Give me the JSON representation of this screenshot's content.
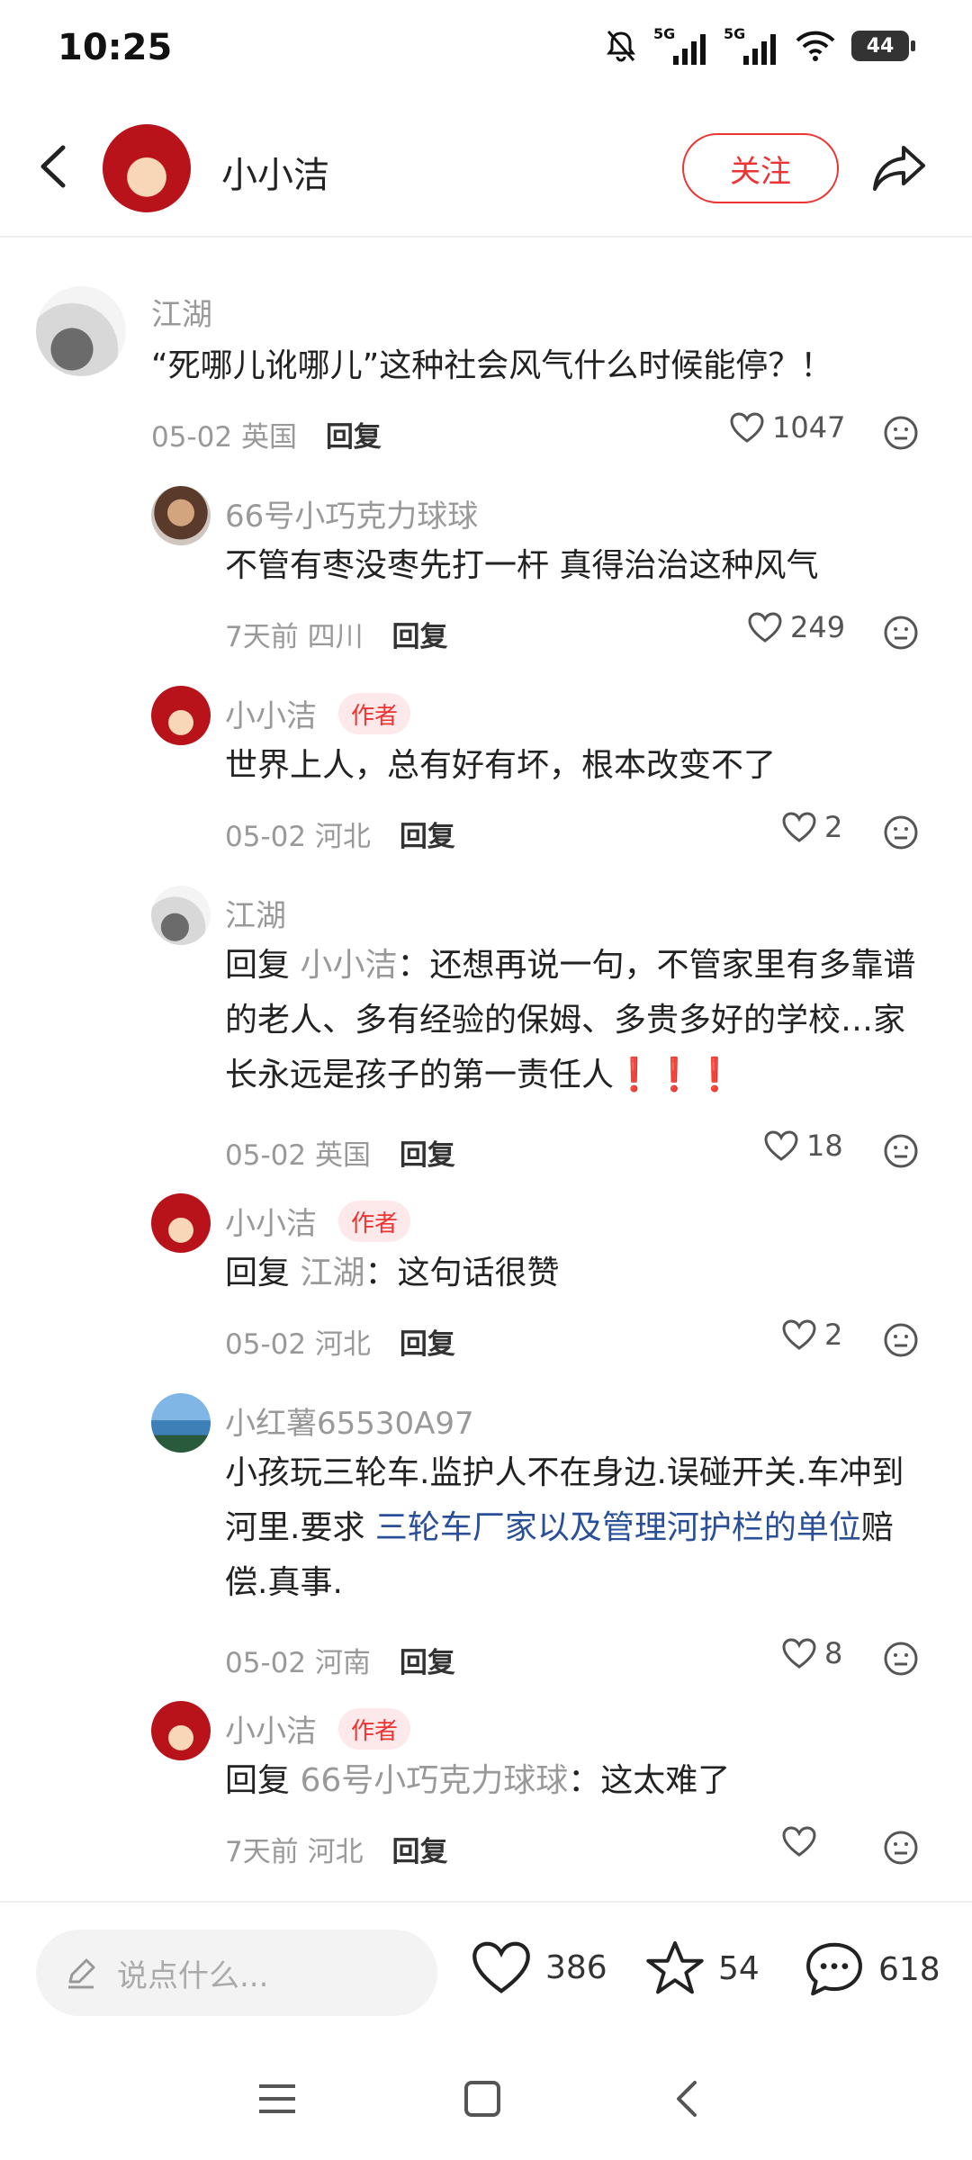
{
  "status_bar": {
    "time": "10:25",
    "net1": "5G",
    "net2": "5G",
    "battery": "44"
  },
  "header": {
    "user_name": "小小洁",
    "follow_label": "关注"
  },
  "comments": [
    {
      "name": "江湖",
      "text": "“死哪儿讹哪儿”这种社会风气什么时候能停？！",
      "date": "05-02",
      "location": "英国",
      "reply_label": "回复",
      "likes": "1047"
    },
    {
      "name": "66号小巧克力球球",
      "text": "不管有枣没枣先打一杆 真得治治这种风气",
      "date": "7天前",
      "location": "四川",
      "reply_label": "回复",
      "likes": "249"
    },
    {
      "name": "小小洁",
      "author_tag": "作者",
      "text": "世界上人，总有好有坏，根本改变不了",
      "date": "05-02",
      "location": "河北",
      "reply_label": "回复",
      "likes": "2"
    },
    {
      "name": "江湖",
      "reply_prefix": "回复",
      "reply_to": "小小洁",
      "text": "：还想再说一句，不管家里有多靠谱的老人、多有经验的保姆、多贵多好的学校…家长永远是孩子的第一责任人",
      "alerts": "❗❗❗",
      "date": "05-02",
      "location": "英国",
      "reply_label": "回复",
      "likes": "18"
    },
    {
      "name": "小小洁",
      "author_tag": "作者",
      "reply_prefix": "回复",
      "reply_to": "江湖",
      "text": "：这句话很赞",
      "date": "05-02",
      "location": "河北",
      "reply_label": "回复",
      "likes": "2"
    },
    {
      "name": "小红薯65530A97",
      "text_before": "小孩玩三轮车.监护人不在身边.误碰开关.车冲到河里.要求 ",
      "link": "三轮车厂家以及管理河护栏的单位",
      "text_after": "赔偿.真事.",
      "date": "05-02",
      "location": "河南",
      "reply_label": "回复",
      "likes": "8"
    },
    {
      "name": "小小洁",
      "author_tag": "作者",
      "reply_prefix": "回复",
      "reply_to": "66号小巧克力球球",
      "text": "：这太难了",
      "date": "7天前",
      "location": "河北",
      "reply_label": "回复",
      "likes": ""
    }
  ],
  "bottom_bar": {
    "input_placeholder": "说点什么...",
    "likes": "386",
    "favorites": "54",
    "comments": "618"
  },
  "colors": {
    "accent": "#ee3333",
    "link": "#2a4f99",
    "muted": "#999999"
  }
}
